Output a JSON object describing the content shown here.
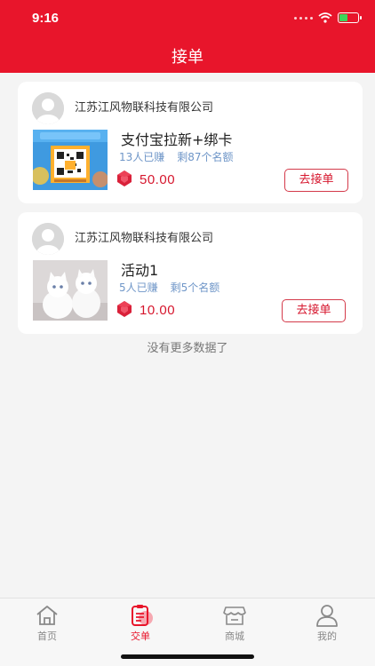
{
  "status_bar": {
    "time": "9:16"
  },
  "header": {
    "title": "接单"
  },
  "tasks": [
    {
      "company": "江苏江风物联科技有限公司",
      "title": "支付宝拉新+绑卡",
      "joined": "13人已赚",
      "remaining": "剩87个名额",
      "price": "50.00",
      "button": "去接单"
    },
    {
      "company": "江苏江风物联科技有限公司",
      "title": "活动1",
      "joined": "5人已赚",
      "remaining": "剩5个名额",
      "price": "10.00",
      "button": "去接单"
    }
  ],
  "list_footer": "没有更多数据了",
  "tabbar": {
    "items": [
      {
        "label": "首页",
        "icon": "home-icon"
      },
      {
        "label": "交单",
        "icon": "clipboard-icon",
        "active": true
      },
      {
        "label": "商城",
        "icon": "store-icon"
      },
      {
        "label": "我的",
        "icon": "user-icon"
      }
    ]
  },
  "colors": {
    "brand": "#e8152b",
    "price": "#d6162d",
    "meta": "#6f96c8"
  }
}
